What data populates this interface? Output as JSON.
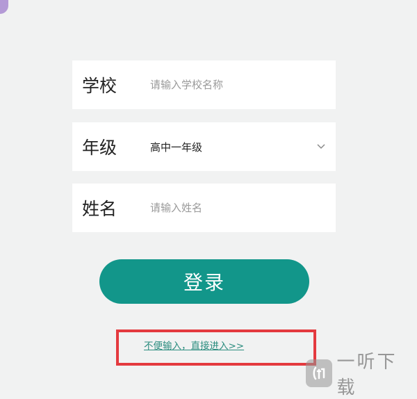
{
  "form": {
    "school": {
      "label": "学校",
      "placeholder": "请输入学校名称",
      "value": ""
    },
    "grade": {
      "label": "年级",
      "selected": "高中一年级"
    },
    "name": {
      "label": "姓名",
      "placeholder": "请输入姓名",
      "value": ""
    }
  },
  "login_button": {
    "label": "登录"
  },
  "skip_link": {
    "label": "不便输入，直接进入>>"
  },
  "watermark": {
    "text": "一听下载"
  },
  "colors": {
    "accent": "#12968a",
    "link": "#2a8c7e",
    "highlight": "#e43a3f",
    "background": "#f1f2f2"
  }
}
